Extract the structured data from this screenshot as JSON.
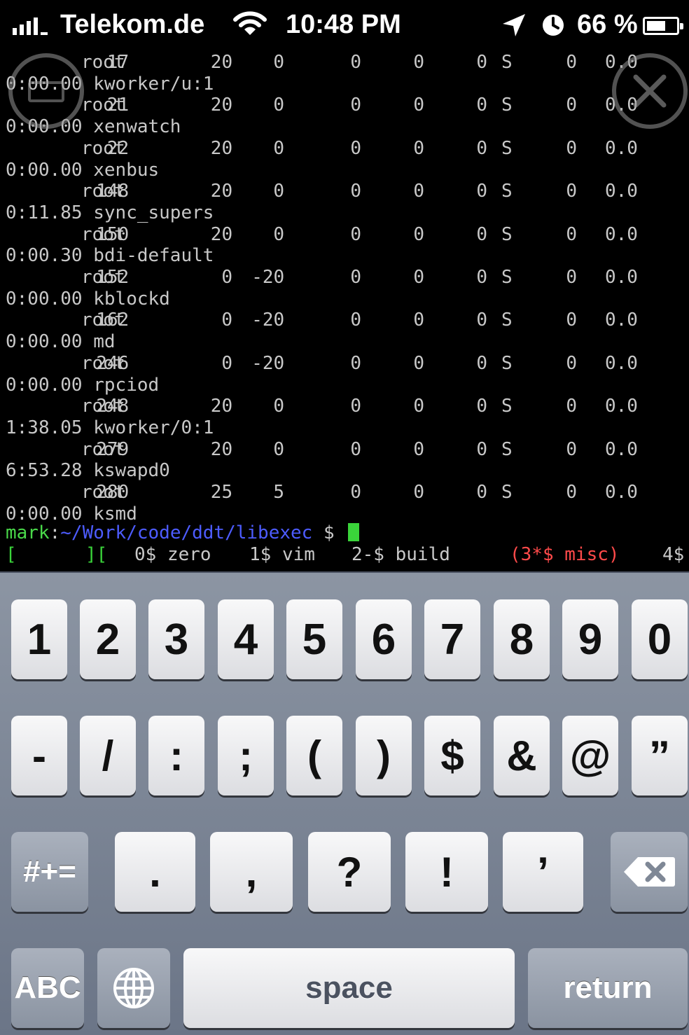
{
  "status_bar": {
    "carrier": "Telekom.de",
    "time": "10:48 PM",
    "battery_percent": "66 %",
    "battery_level": 0.66,
    "icons": [
      "signal-icon",
      "wifi-icon",
      "location-icon",
      "alarm-clock-icon",
      "battery-icon"
    ]
  },
  "terminal": {
    "process_rows": [
      {
        "pid": "17",
        "user": "root",
        "pr": "20",
        "ni": "0",
        "virt": "0",
        "res": "0",
        "shr": "0",
        "s": "S",
        "cpu": "0",
        "mem": "0.0",
        "time": "0:00.00",
        "command": "kworker/u:1"
      },
      {
        "pid": "21",
        "user": "root",
        "pr": "20",
        "ni": "0",
        "virt": "0",
        "res": "0",
        "shr": "0",
        "s": "S",
        "cpu": "0",
        "mem": "0.0",
        "time": "0:00.00",
        "command": "xenwatch"
      },
      {
        "pid": "22",
        "user": "root",
        "pr": "20",
        "ni": "0",
        "virt": "0",
        "res": "0",
        "shr": "0",
        "s": "S",
        "cpu": "0",
        "mem": "0.0",
        "time": "0:00.00",
        "command": "xenbus"
      },
      {
        "pid": "148",
        "user": "root",
        "pr": "20",
        "ni": "0",
        "virt": "0",
        "res": "0",
        "shr": "0",
        "s": "S",
        "cpu": "0",
        "mem": "0.0",
        "time": "0:11.85",
        "command": "sync_supers"
      },
      {
        "pid": "150",
        "user": "root",
        "pr": "20",
        "ni": "0",
        "virt": "0",
        "res": "0",
        "shr": "0",
        "s": "S",
        "cpu": "0",
        "mem": "0.0",
        "time": "0:00.30",
        "command": "bdi-default"
      },
      {
        "pid": "152",
        "user": "root",
        "pr": "0",
        "ni": "-20",
        "virt": "0",
        "res": "0",
        "shr": "0",
        "s": "S",
        "cpu": "0",
        "mem": "0.0",
        "time": "0:00.00",
        "command": "kblockd"
      },
      {
        "pid": "162",
        "user": "root",
        "pr": "0",
        "ni": "-20",
        "virt": "0",
        "res": "0",
        "shr": "0",
        "s": "S",
        "cpu": "0",
        "mem": "0.0",
        "time": "0:00.00",
        "command": "md"
      },
      {
        "pid": "246",
        "user": "root",
        "pr": "0",
        "ni": "-20",
        "virt": "0",
        "res": "0",
        "shr": "0",
        "s": "S",
        "cpu": "0",
        "mem": "0.0",
        "time": "0:00.00",
        "command": "rpciod"
      },
      {
        "pid": "248",
        "user": "root",
        "pr": "20",
        "ni": "0",
        "virt": "0",
        "res": "0",
        "shr": "0",
        "s": "S",
        "cpu": "0",
        "mem": "0.0",
        "time": "1:38.05",
        "command": "kworker/0:1"
      },
      {
        "pid": "279",
        "user": "root",
        "pr": "20",
        "ni": "0",
        "virt": "0",
        "res": "0",
        "shr": "0",
        "s": "S",
        "cpu": "0",
        "mem": "0.0",
        "time": "6:53.28",
        "command": "kswapd0"
      },
      {
        "pid": "280",
        "user": "root",
        "pr": "25",
        "ni": "5",
        "virt": "0",
        "res": "0",
        "shr": "0",
        "s": "S",
        "cpu": "0",
        "mem": "0.0",
        "time": "0:00.00",
        "command": "ksmd"
      }
    ],
    "prompt": {
      "user": "mark",
      "separator": ":",
      "path": "~/Work/code/ddt/libexec",
      "sign": " $ "
    },
    "screen_bar": {
      "open_bracket": "[",
      "host_close": "][",
      "windows": [
        {
          "label": "0$ zero"
        },
        {
          "label": "1$ vim"
        },
        {
          "label": "2-$ build"
        },
        {
          "label": "(3*$ misc)"
        },
        {
          "label": "4$"
        }
      ]
    },
    "colors": {
      "text": "#c8c8c8",
      "prompt_user": "#4ad94a",
      "prompt_path": "#4d5cff",
      "active_window": "#ff4a4a",
      "cursor": "#3ad43a"
    }
  },
  "overlay": {
    "left_button_icon": "keyboard-icon",
    "right_button_icon": "close-icon"
  },
  "keyboard": {
    "row1": [
      "1",
      "2",
      "3",
      "4",
      "5",
      "6",
      "7",
      "8",
      "9",
      "0"
    ],
    "row2": [
      "-",
      "/",
      ":",
      ";",
      "(",
      ")",
      "$",
      "&",
      "@",
      "”"
    ],
    "row3_mode": "#+=",
    "row3": [
      ".",
      ",",
      "?",
      "!",
      "’"
    ],
    "backspace_icon": "backspace-icon",
    "mode_abc": "ABC",
    "globe_icon": "globe-icon",
    "space": "space",
    "return": "return"
  }
}
